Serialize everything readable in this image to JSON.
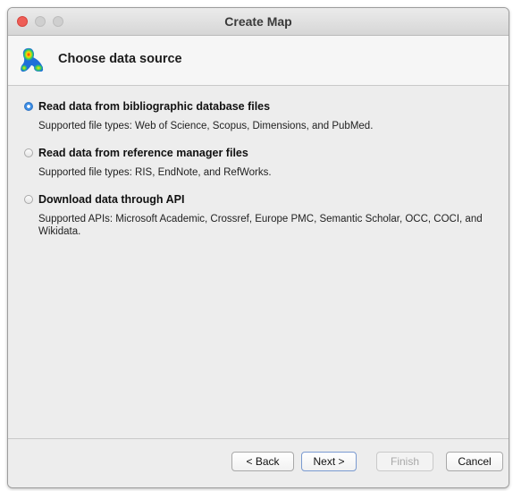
{
  "window": {
    "title": "Create Map"
  },
  "header": {
    "title": "Choose data source",
    "icon": "heatmap-logo-icon"
  },
  "options": [
    {
      "label": "Read data from bibliographic database files",
      "description": "Supported file types: Web of Science, Scopus, Dimensions, and PubMed.",
      "selected": true
    },
    {
      "label": "Read data from reference manager files",
      "description": "Supported file types: RIS, EndNote, and RefWorks.",
      "selected": false
    },
    {
      "label": "Download data through API",
      "description": "Supported APIs: Microsoft Academic, Crossref, Europe PMC, Semantic Scholar, OCC, COCI, and Wikidata.",
      "selected": false
    }
  ],
  "buttons": {
    "back": "< Back",
    "next": "Next >",
    "finish": "Finish",
    "cancel": "Cancel"
  },
  "colors": {
    "radio_selected": "#3d8ee5",
    "close_button": "#ee5e57"
  }
}
